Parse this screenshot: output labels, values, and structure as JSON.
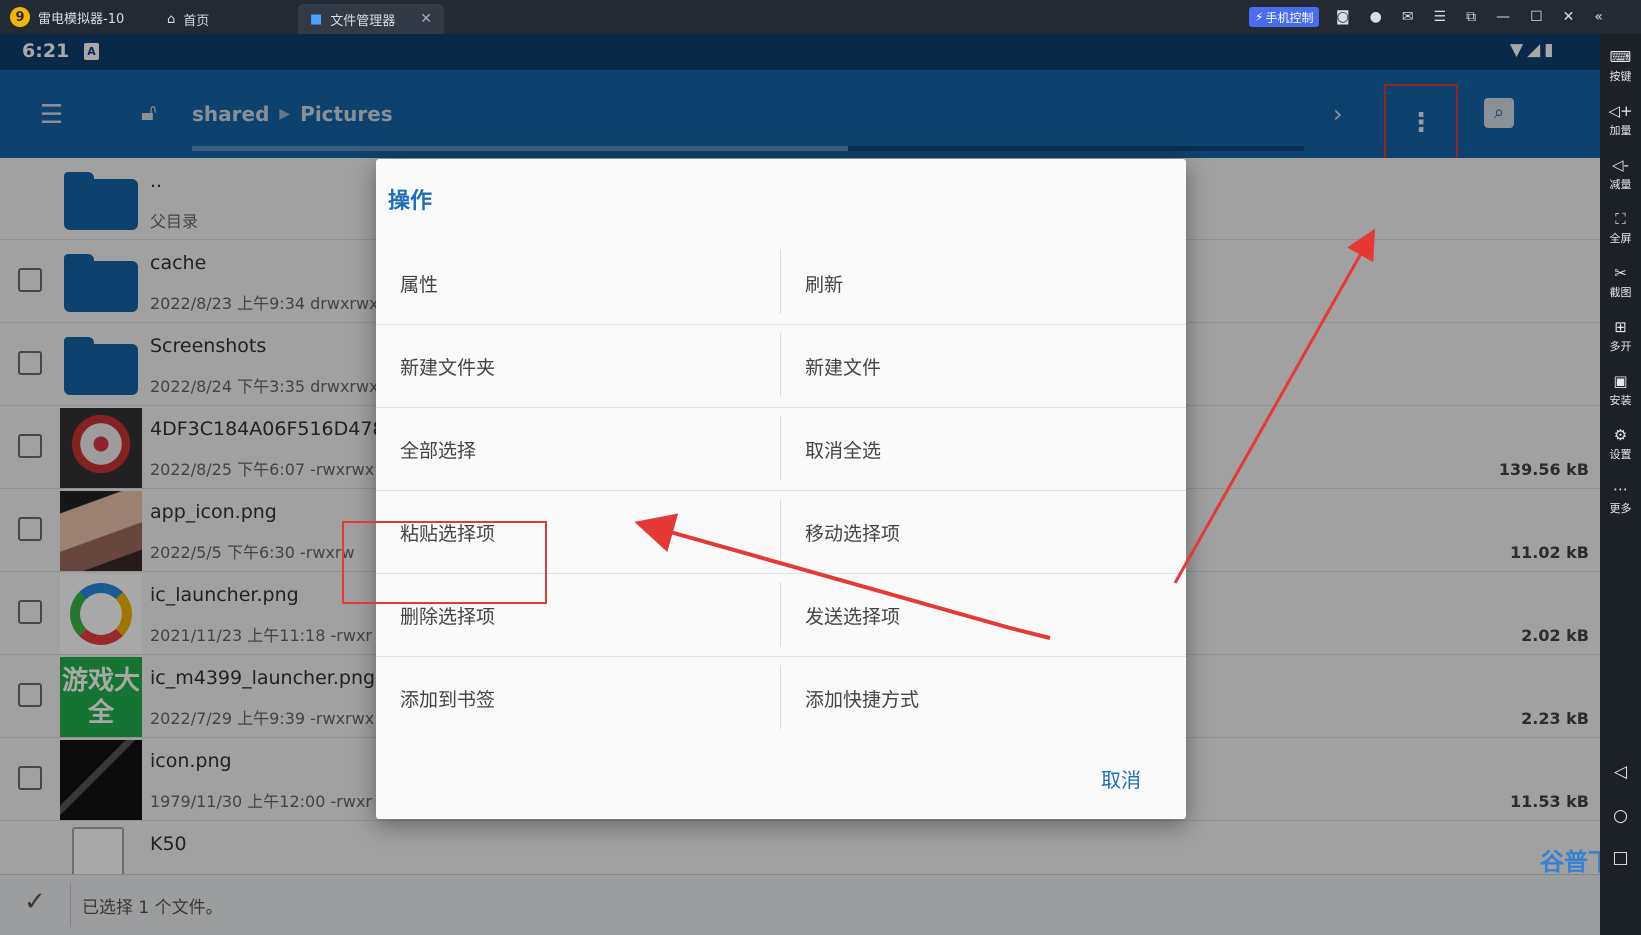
{
  "titlebar": {
    "app_name": "雷电模拟器-10",
    "tabs": [
      {
        "label": "首页"
      },
      {
        "label": "文件管理器"
      }
    ],
    "phone_control": "手机控制"
  },
  "sidebar": {
    "items": [
      {
        "label": "按键",
        "icon": "keyboard-icon"
      },
      {
        "label": "加量",
        "icon": "volume-up-icon"
      },
      {
        "label": "减量",
        "icon": "volume-down-icon"
      },
      {
        "label": "全屏",
        "icon": "fullscreen-icon"
      },
      {
        "label": "截图",
        "icon": "scissors-icon"
      },
      {
        "label": "多开",
        "icon": "multi-instance-icon"
      },
      {
        "label": "安装",
        "icon": "apk-icon"
      },
      {
        "label": "设置",
        "icon": "settings-icon"
      },
      {
        "label": "更多",
        "icon": "more-icon"
      }
    ]
  },
  "status": {
    "time": "6:21",
    "a_icon": "A"
  },
  "toolbar": {
    "path": [
      "shared",
      "Pictures"
    ],
    "progress": 0.59
  },
  "files": [
    {
      "name": "..",
      "meta": "父目录",
      "size": "",
      "type": "folder",
      "checkbox": false
    },
    {
      "name": "cache",
      "meta": "2022/8/23 上午9:34   drwxrwx",
      "size": "",
      "type": "folder",
      "checkbox": true
    },
    {
      "name": "Screenshots",
      "meta": "2022/8/24 下午3:35   drwxrwx",
      "size": "",
      "type": "folder",
      "checkbox": true
    },
    {
      "name": "4DF3C184A06F516D478",
      "meta": "2022/8/25 下午6:07   -rwxrwx",
      "size": "139.56 kB",
      "type": "doraemon",
      "checkbox": true
    },
    {
      "name": "app_icon.png",
      "meta": "2022/5/5 下午6:30   -rwxrw",
      "size": "11.02 kB",
      "type": "anime",
      "checkbox": true
    },
    {
      "name": "ic_launcher.png",
      "meta": "2021/11/23 上午11:18   -rwxr",
      "size": "2.02 kB",
      "type": "launcher",
      "checkbox": true
    },
    {
      "name": "ic_m4399_launcher.png",
      "meta": "2022/7/29 上午9:39   -rwxrwx",
      "size": "2.23 kB",
      "type": "game",
      "checkbox": true
    },
    {
      "name": "icon.png",
      "meta": "1979/11/30 上午12:00   -rwxr",
      "size": "11.53 kB",
      "type": "icon",
      "checkbox": true
    },
    {
      "name": "K50",
      "meta": "",
      "size": "",
      "type": "doc",
      "checkbox": false
    }
  ],
  "game_thumb_text": "游戏大全",
  "bottombar": {
    "message": "已选择 1 个文件。"
  },
  "dialog": {
    "title": "操作",
    "rows": [
      [
        "属性",
        "刷新"
      ],
      [
        "新建文件夹",
        "新建文件"
      ],
      [
        "全部选择",
        "取消全选"
      ],
      [
        "粘贴选择项",
        "移动选择项"
      ],
      [
        "删除选择项",
        "发送选择项"
      ],
      [
        "添加到书签",
        "添加快捷方式"
      ]
    ],
    "cancel": "取消"
  },
  "watermark": "谷普下载",
  "colors": {
    "accent": "#1565a8",
    "status_bar": "#0d3f70",
    "highlight": "#e53935"
  }
}
